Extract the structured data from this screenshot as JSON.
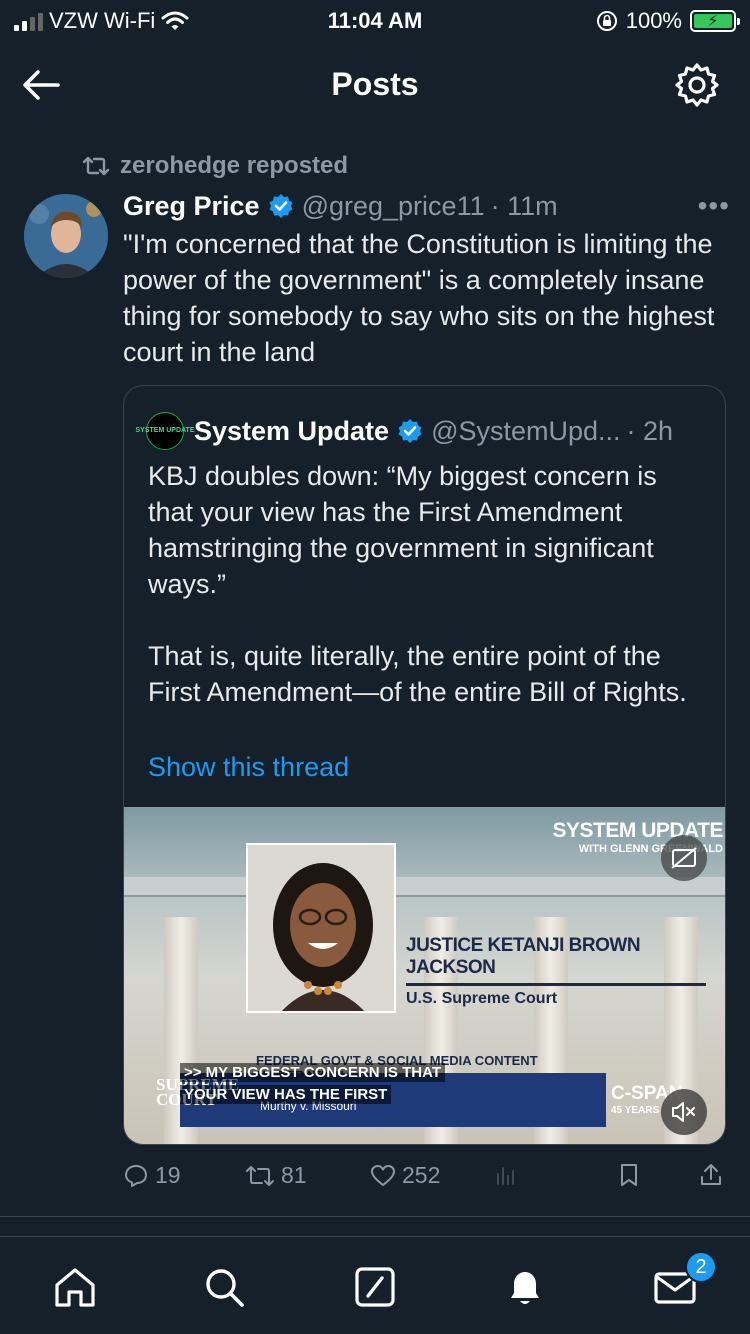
{
  "status_bar": {
    "carrier": "VZW Wi-Fi",
    "time": "11:04 AM",
    "battery_percent": "100%"
  },
  "header": {
    "title": "Posts"
  },
  "repost": {
    "label": "zerohedge reposted"
  },
  "tweet": {
    "author_name": "Greg Price",
    "handle": "@greg_price11",
    "time": "· 11m",
    "more": "•••",
    "text": "\"I'm concerned that the Constitution is limiting the power of the government\" is a completely insane thing for somebody to say who sits on the highest court in the land",
    "quote": {
      "logo_text": "SYSTEM UPDATE",
      "author_name": "System Update",
      "handle": "@SystemUpd...",
      "time": "· 2h",
      "paragraph1": "KBJ doubles down: “My biggest concern is that your view has the First Amendment hamstringing the government in significant ways.”",
      "paragraph2": "That is, quite literally, the entire point of the First Amendment—of the entire Bill of Rights.",
      "show_thread": "Show this thread",
      "media": {
        "brand_title": "SYSTEM UPDATE",
        "brand_sub": "WITH GLENN GREENWALD",
        "name_plate": "JUSTICE KETANJI BROWN JACKSON",
        "name_sub": "U.S. Supreme Court",
        "lower_header": "FEDERAL GOV'T & SOCIAL MEDIA CONTENT MODERATION",
        "caption_line1": ">> MY BIGGEST CONCERN IS THAT",
        "caption_line2": "YOUR VIEW HAS THE FIRST",
        "case_name": "Murthy v. Missouri",
        "court_tag": "SUPREME COURT",
        "network": "C-SPAN",
        "network_sub": "45 YEARS"
      }
    },
    "stats": {
      "replies": "19",
      "reposts": "81",
      "likes": "252"
    }
  },
  "tabbar": {
    "messages_badge": "2"
  },
  "colors": {
    "background": "#15202b",
    "accent": "#1d9bf0",
    "muted": "#8b98a5",
    "border": "#38444d"
  }
}
